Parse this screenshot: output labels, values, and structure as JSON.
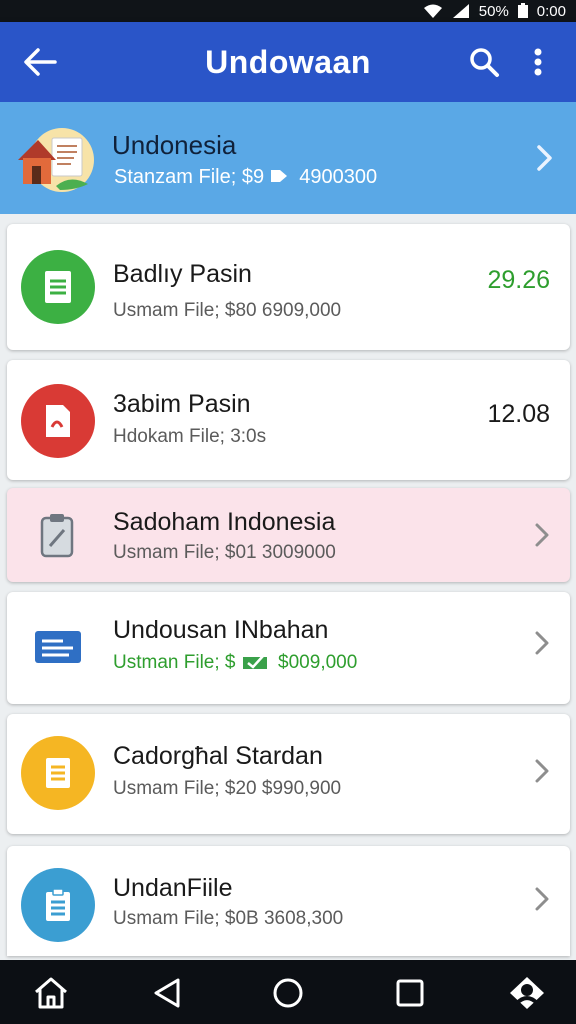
{
  "status_bar": {
    "battery": "50%",
    "time": "0:00",
    "icons": [
      "wifi-icon",
      "signal-icon",
      "battery-icon"
    ]
  },
  "app_bar": {
    "title": "Undowaan",
    "icons": [
      "back-arrow-icon",
      "search-icon",
      "more-vert-icon"
    ]
  },
  "header": {
    "title": "Undonesia",
    "subtitle": "Stanzam File; $9",
    "subtitle_amount": "4900300"
  },
  "items": [
    {
      "title": "Badlıy Pasin",
      "subtitle": "Usmam File; $80  6909,000",
      "value": "29.26",
      "value_color": "#2e9e2e",
      "icon": "document-icon",
      "icon_color": "#3cb043"
    },
    {
      "title": "3abim Pasin",
      "subtitle": "Hdokam File; 3:0s",
      "value": "12.08",
      "value_color": "#1a1a1a",
      "icon": "pdf-file-icon",
      "icon_color": "#d93a35"
    },
    {
      "title": "Sadoham Indonesia",
      "subtitle": "Usmam File; $01  3009000",
      "icon": "clipboard-pen-icon",
      "icon_color": "#8a9099"
    },
    {
      "title": "Undousan INbahan",
      "subtitle_prefix": "Ustman File; $",
      "subtitle_amount": "$009,000",
      "icon": "id-card-icon",
      "icon_color": "#2f6fc4"
    },
    {
      "title": "Cadorgħal Stardan",
      "subtitle": "Usmam File; $20  $990,900",
      "icon": "note-icon",
      "icon_color": "#f5b623"
    },
    {
      "title": "UndanFiile",
      "subtitle": "Usmam File; $0B  3608,300",
      "icon": "clipboard-icon",
      "icon_color": "#3b9ed2"
    }
  ],
  "nav_bar": {
    "icons": [
      "home-icon",
      "back-triangle-icon",
      "home-circle-icon",
      "recents-square-icon",
      "assistant-icon"
    ]
  }
}
